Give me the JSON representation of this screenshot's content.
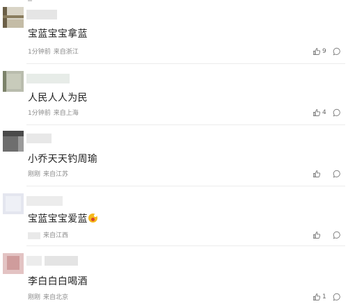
{
  "comments": [
    {
      "text": "宝蓝宝宝拿蓝",
      "time": "1分钟前",
      "location": "来自浙江",
      "likes": "9",
      "like_icon": "thumbs-up-icon",
      "reply_icon": "reply-bubble-icon"
    },
    {
      "text": "人民人人为民",
      "time": "1分钟前",
      "location": "来自上海",
      "likes": "4",
      "like_icon": "thumbs-up-icon",
      "reply_icon": "reply-bubble-icon"
    },
    {
      "text": "小乔天天钓周瑜",
      "time": "刚刚",
      "location": "来自江苏",
      "likes": "",
      "like_icon": "thumbs-up-icon",
      "reply_icon": "reply-bubble-icon"
    },
    {
      "text": "宝蓝宝宝爱蓝",
      "time": "",
      "location": "来自江西",
      "likes": "",
      "emoji": "hot-face-emoji",
      "like_icon": "thumbs-up-icon",
      "reply_icon": "reply-bubble-icon"
    },
    {
      "text": "李白白白喝酒",
      "time": "刚刚",
      "location": "来自北京",
      "likes": "1",
      "like_icon": "thumbs-up-icon",
      "reply_icon": "reply-bubble-icon"
    }
  ],
  "colors": {
    "text": "#222222",
    "meta": "#8a8a8a",
    "divider": "#ececec"
  }
}
